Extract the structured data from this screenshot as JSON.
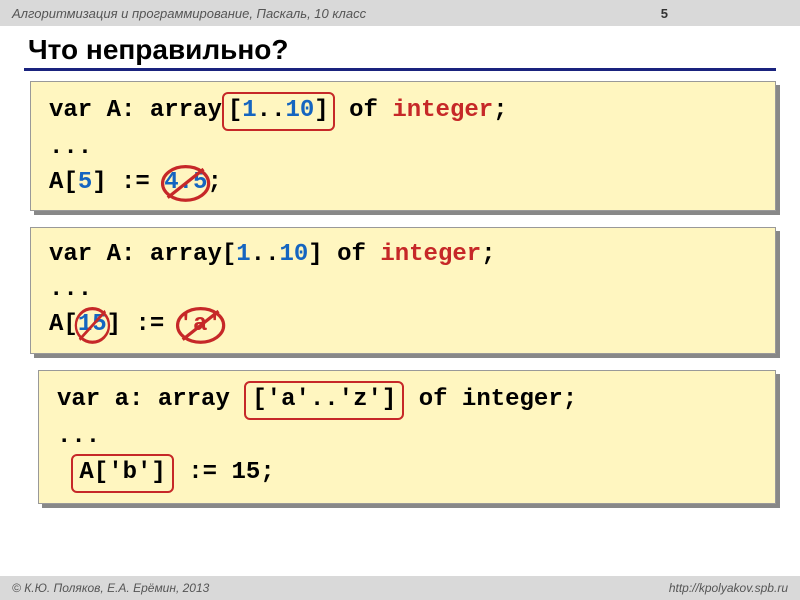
{
  "header": {
    "course": "Алгоритмизация и программирование, Паскаль, 10 класс",
    "slide_number": "5"
  },
  "title": "Что неправильно?",
  "block1": {
    "var_kw": "var",
    "varname": "A",
    "array_kw": "array",
    "range_low": "1",
    "range_dots": "..",
    "range_high": "10",
    "of_kw": "of",
    "type": "integer",
    "dots": "...",
    "assign_target_open": "A[",
    "assign_index": "5",
    "assign_close": "]",
    "assign_op": ":=",
    "wrong_value": "4.5",
    "semicolon": ";"
  },
  "block2": {
    "var_kw": "var",
    "varname": "A",
    "array_kw": "array",
    "range_low": "1",
    "range_dots": "..",
    "range_high": "10",
    "of_kw": "of",
    "type": "integer",
    "dots": "...",
    "assign_target_open": "A[",
    "wrong_index": "15",
    "assign_close": "]",
    "assign_op": ":=",
    "wrong_value": "'a'"
  },
  "block3": {
    "var_kw": "var",
    "varname": "a",
    "array_kw": "array",
    "range_box": "['a'..'z']",
    "of_kw": "of",
    "type": "integer",
    "dots": "...",
    "lhs_box": "A['b']",
    "assign_op": ":=",
    "value": "15",
    "semicolon": ";"
  },
  "footer": {
    "authors": "К.Ю. Поляков, Е.А. Ерёмин, 2013",
    "url": "http://kpolyakov.spb.ru"
  }
}
